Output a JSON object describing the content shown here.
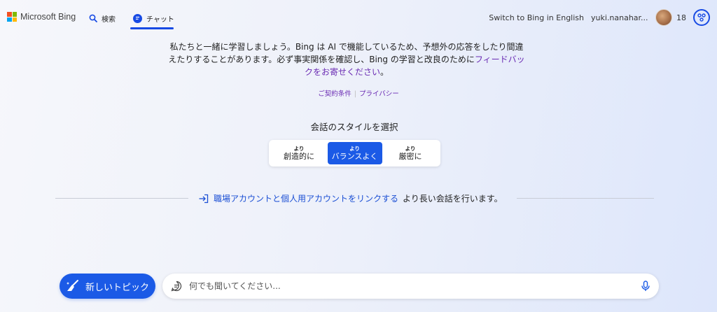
{
  "header": {
    "brand": "Microsoft Bing",
    "tabs": [
      {
        "label": "検索",
        "icon": "search-icon"
      },
      {
        "label": "チャット",
        "icon": "chat-icon",
        "active": true
      }
    ],
    "switch_language": "Switch to Bing in English",
    "username": "yuki.nanahar...",
    "rewards_count": "18"
  },
  "disclaimer": {
    "text": "私たちと一緒に学習しましょう。Bing は AI で機能しているため、予想外の応答をしたり間違えたりすることがあります。必ず事実関係を確認し、Bing の学習と改良のために",
    "feedback_link": "フィードバックをお寄せください",
    "end": "。"
  },
  "legal": {
    "terms": "ご契約条件",
    "privacy": "プライバシー"
  },
  "conversation_style": {
    "title": "会話のスタイルを選択",
    "options": [
      {
        "small": "より",
        "label": "創造的に",
        "active": false
      },
      {
        "small": "より",
        "label": "バランスよく",
        "active": true
      },
      {
        "small": "より",
        "label": "厳密に",
        "active": false
      }
    ]
  },
  "account_link": {
    "link_text": "職場アカウントと個人用アカウントをリンクする",
    "suffix": " より長い会話を行います。"
  },
  "bottom": {
    "new_topic": "新しいトピック",
    "input_placeholder": "何でも聞いてください..."
  },
  "colors": {
    "accent": "#1b5ae6",
    "link_purple": "#6a2bb3"
  }
}
